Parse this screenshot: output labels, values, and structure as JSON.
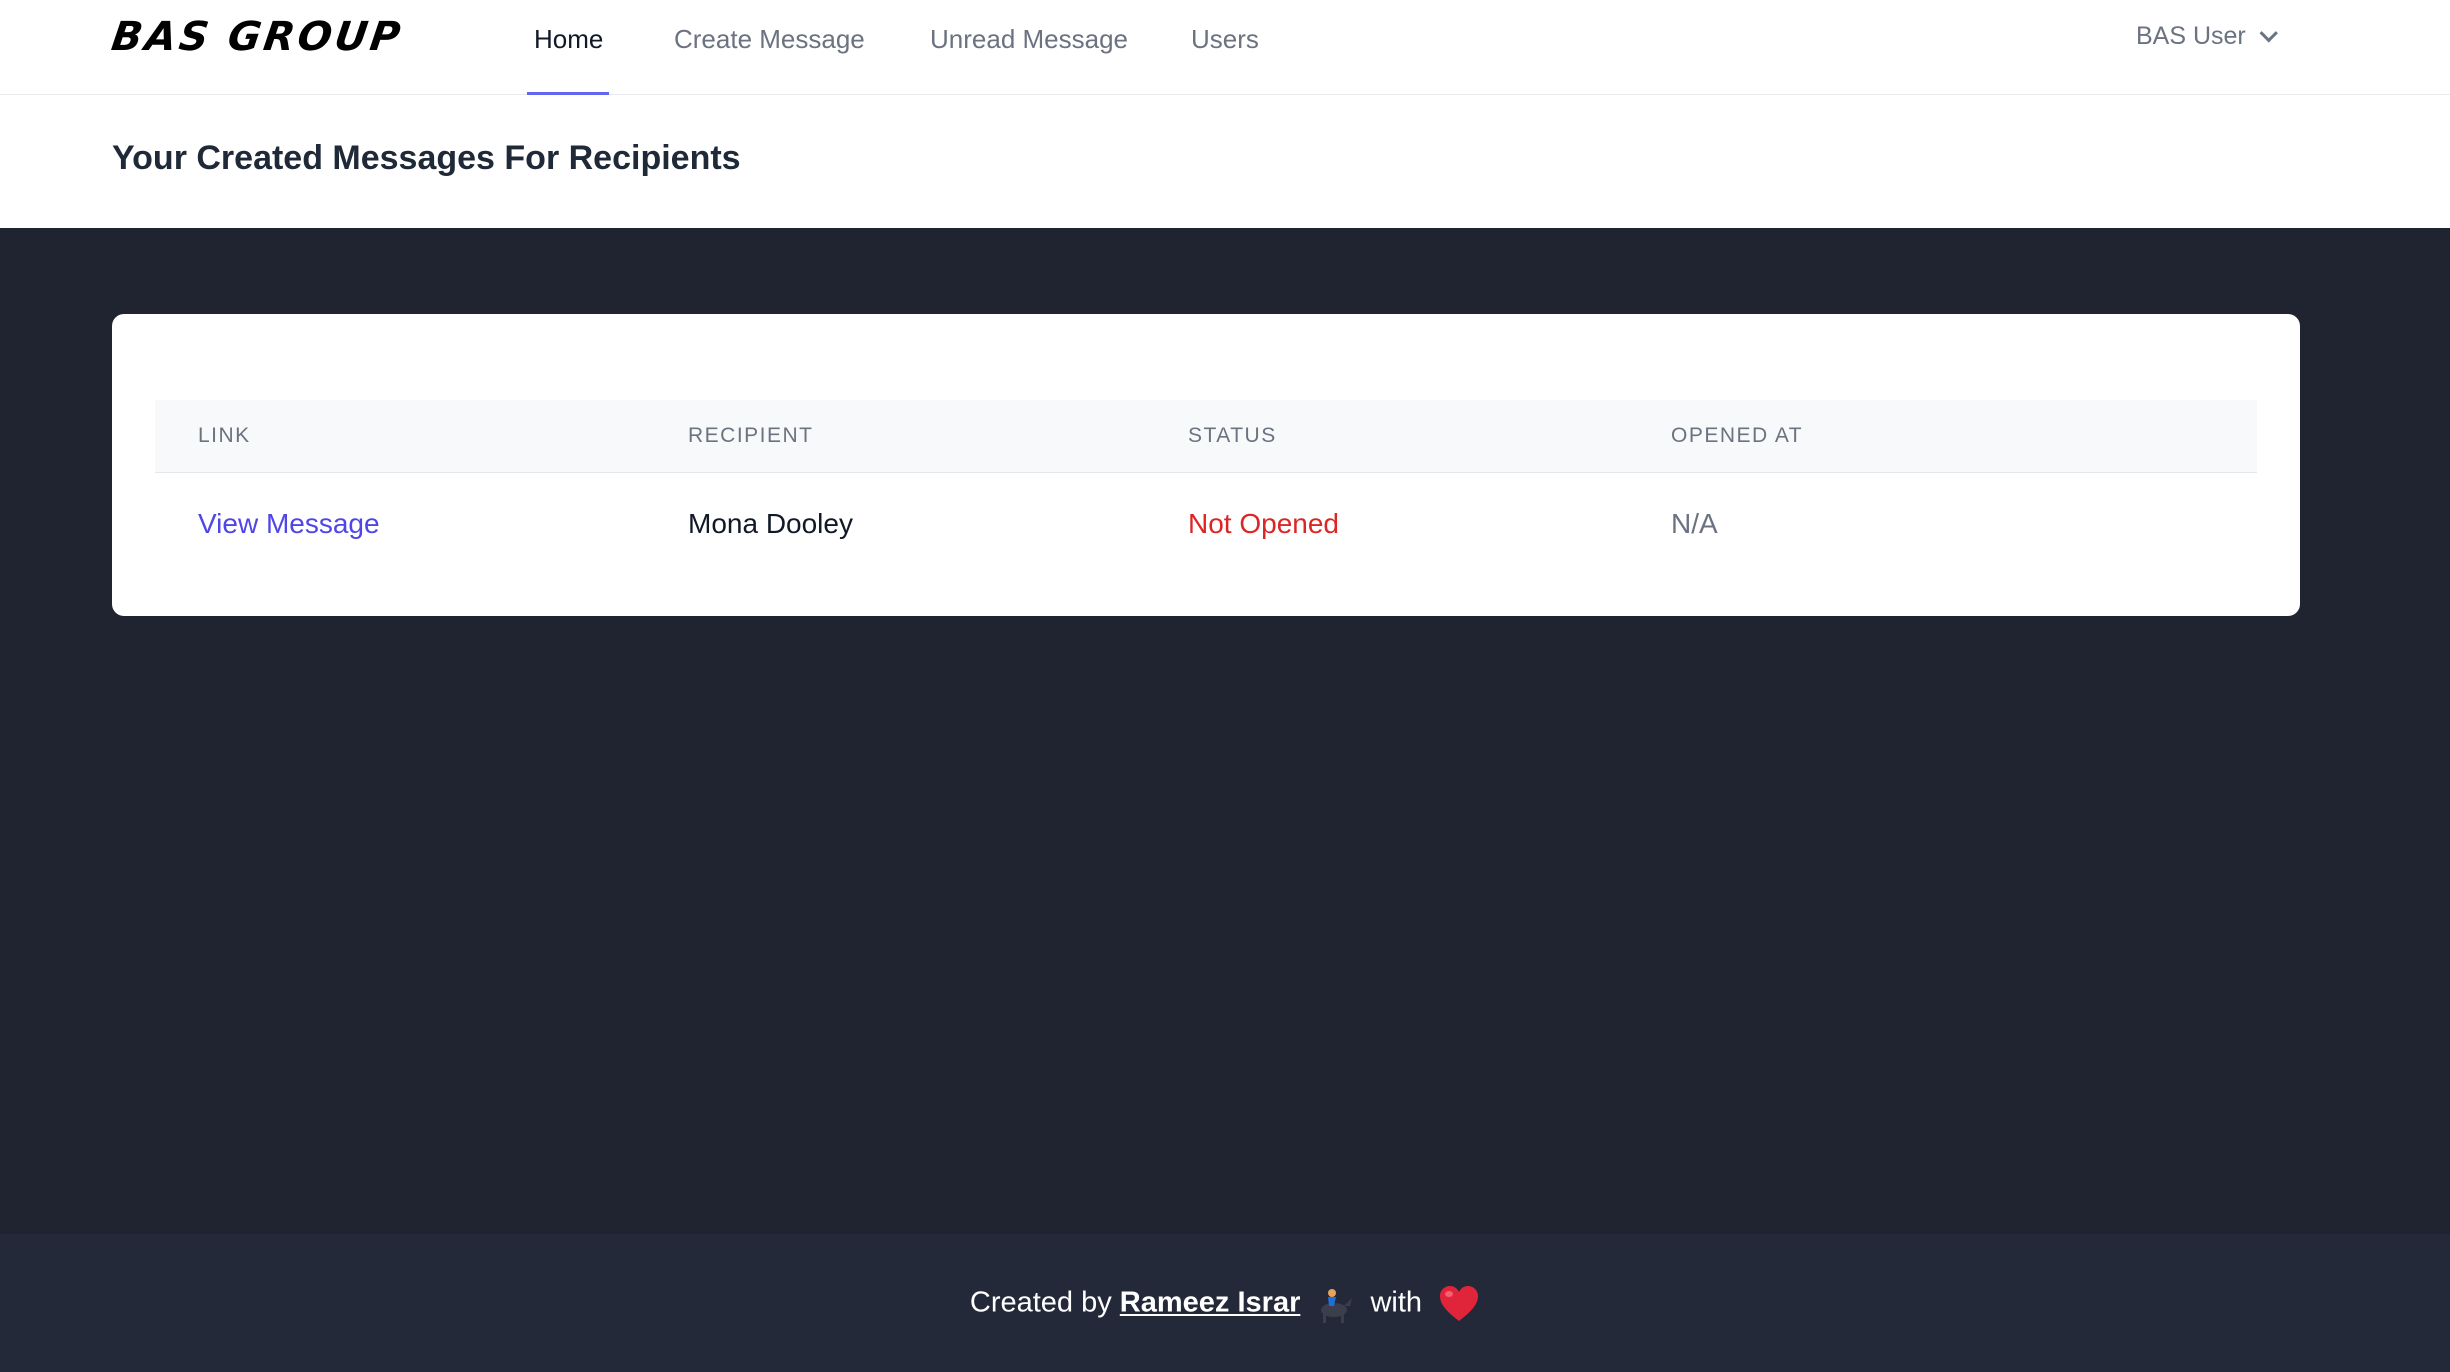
{
  "nav": {
    "logo": "BAS GROUP",
    "items": [
      {
        "label": "Home"
      },
      {
        "label": "Create Message"
      },
      {
        "label": "Unread Message"
      },
      {
        "label": "Users"
      }
    ],
    "user_label": "BAS User",
    "accent": "#6366f1"
  },
  "header": {
    "title": "Your Created Messages For Recipients"
  },
  "table": {
    "columns": [
      "LINK",
      "RECIPIENT",
      "STATUS",
      "OPENED AT"
    ],
    "rows": [
      {
        "link": "View Message",
        "recipient": "Mona Dooley",
        "status": "Not Opened",
        "opened_at": "N/A"
      }
    ]
  },
  "footer": {
    "prefix": "Created by",
    "author": "Rameez Israr",
    "with": "with",
    "icons": [
      "horse-racing-icon",
      "heart-icon"
    ]
  },
  "colors": {
    "page_bg": "#1f2430",
    "link": "#4f46e5",
    "status_not_opened": "#dc2626"
  }
}
